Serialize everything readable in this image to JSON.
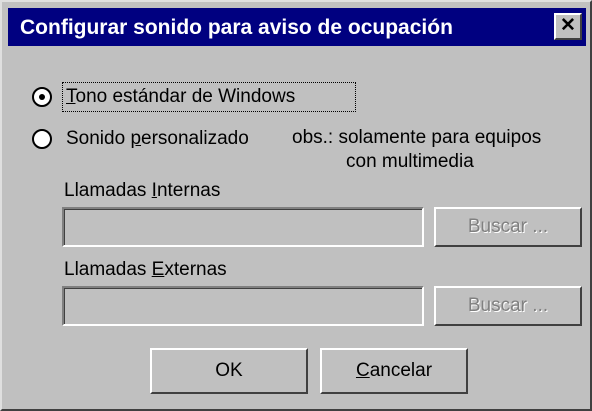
{
  "window": {
    "title": "Configurar sonido para aviso de ocupación",
    "close_label": "✕"
  },
  "radio_options": [
    {
      "label_pre": "",
      "accel": "T",
      "label_post": "ono estándar de Windows",
      "checked": true
    },
    {
      "label_pre": "Sonido ",
      "accel": "p",
      "label_post": "ersonalizado",
      "checked": false
    }
  ],
  "note": {
    "line1": "obs.: solamente para equipos",
    "line2": "con multimedia"
  },
  "internal_calls": {
    "label_pre": "Llamadas ",
    "accel": "I",
    "label_post": "nternas",
    "value": "",
    "browse_label": "Buscar ..."
  },
  "external_calls": {
    "label_pre": "Llamadas ",
    "accel": "E",
    "label_post": "xternas",
    "value": "",
    "browse_label": "Buscar ..."
  },
  "buttons": {
    "ok_label": "OK",
    "cancel_accel": "C",
    "cancel_rest": "ancelar"
  }
}
